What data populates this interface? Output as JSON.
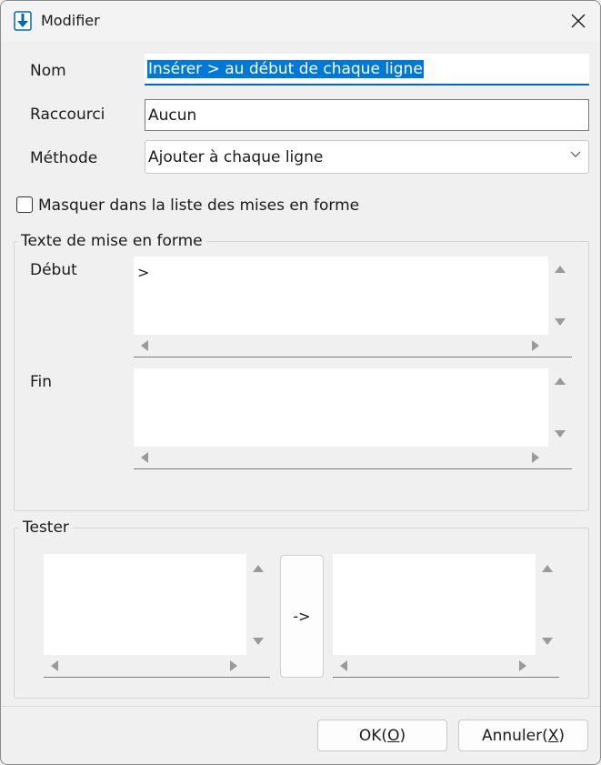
{
  "window": {
    "title": "Modifier",
    "icon": "download-arrow-icon",
    "accent": "#0067c0"
  },
  "form": {
    "nom_label": "Nom",
    "nom_value": "Insérer > au début de chaque ligne",
    "raccourci_label": "Raccourci",
    "raccourci_value": "Aucun",
    "methode_label": "Méthode",
    "methode_value": "Ajouter à chaque ligne",
    "hide_checkbox_label": "Masquer dans la liste des mises en forme",
    "hide_checked": false
  },
  "format_group": {
    "title": "Texte de mise en forme",
    "debut_label": "Début",
    "debut_value": ">",
    "fin_label": "Fin",
    "fin_value": ""
  },
  "tester_group": {
    "title": "Tester",
    "input_value": "",
    "convert_label": "->",
    "output_value": ""
  },
  "buttons": {
    "ok_text": "OK(",
    "ok_key": "O",
    "ok_end": ")",
    "cancel_text": "Annuler(",
    "cancel_key": "X",
    "cancel_end": ")"
  }
}
